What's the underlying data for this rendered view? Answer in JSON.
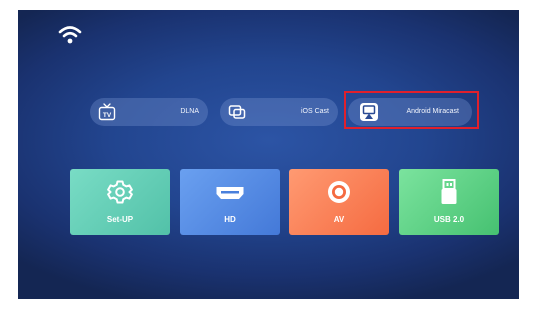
{
  "status_bar": {
    "wifi_icon": "wifi-icon"
  },
  "cast_options": [
    {
      "label": "DLNA",
      "icon": "tv-icon"
    },
    {
      "label": "iOS Cast",
      "icon": "screen-mirror-icon"
    },
    {
      "label": "Android Miracast",
      "icon": "miracast-icon",
      "highlighted": true
    }
  ],
  "source_tiles": [
    {
      "label": "Set-UP",
      "icon": "gear-icon",
      "color": "#5fcfb5"
    },
    {
      "label": "HD",
      "icon": "hdmi-icon",
      "color": "#5189e2"
    },
    {
      "label": "AV",
      "icon": "av-icon",
      "color": "#f77a50"
    },
    {
      "label": "USB 2.0",
      "icon": "usb-icon",
      "color": "#5ccf82"
    }
  ],
  "colors": {
    "background": "#22458f",
    "highlight_border": "#e0202c"
  }
}
